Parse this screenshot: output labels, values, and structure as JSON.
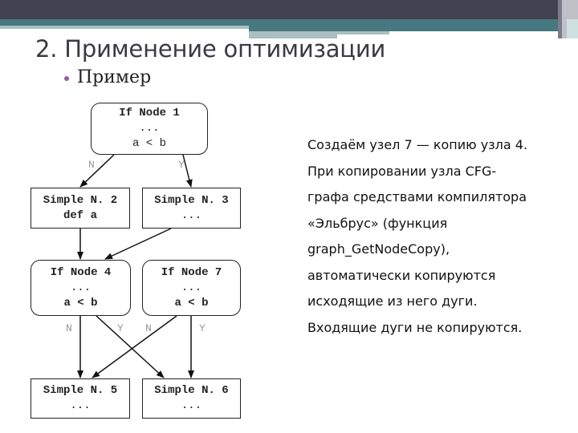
{
  "slide": {
    "title": "2. Применение оптимизации",
    "bullet": "Пример",
    "theme_colors": {
      "top_bar": "#41414f",
      "accent_teal": "#47787f",
      "accent_light": "#a9bfc1",
      "bullet": "#9a5aa0"
    }
  },
  "diagram": {
    "nodes": [
      {
        "id": "n1",
        "kind": "if",
        "lines": [
          "If Node 1",
          "...",
          "a < b"
        ]
      },
      {
        "id": "n2",
        "kind": "simple",
        "lines": [
          "Simple N. 2",
          "def a"
        ]
      },
      {
        "id": "n3",
        "kind": "simple",
        "lines": [
          "Simple N. 3",
          "..."
        ]
      },
      {
        "id": "n4",
        "kind": "if",
        "lines": [
          "If Node 4",
          "...",
          "a < b"
        ]
      },
      {
        "id": "n7",
        "kind": "if",
        "lines": [
          "If Node 7",
          "...",
          "a < b"
        ]
      },
      {
        "id": "n5",
        "kind": "simple",
        "lines": [
          "Simple N. 5",
          "..."
        ]
      },
      {
        "id": "n6",
        "kind": "simple",
        "lines": [
          "Simple N. 6",
          "..."
        ]
      }
    ],
    "edges": [
      {
        "from": "n1",
        "to": "n2",
        "label": "N"
      },
      {
        "from": "n1",
        "to": "n3",
        "label": "Y"
      },
      {
        "from": "n2",
        "to": "n4",
        "label": ""
      },
      {
        "from": "n3",
        "to": "n4",
        "label": ""
      },
      {
        "from": "n4",
        "to": "n5",
        "label": "N"
      },
      {
        "from": "n4",
        "to": "n6",
        "label": "Y"
      },
      {
        "from": "n7",
        "to": "n5",
        "label": "N"
      },
      {
        "from": "n7",
        "to": "n6",
        "label": "Y"
      }
    ]
  },
  "description": {
    "lines": [
      "Создаём узел 7 — копию узла 4.",
      "При копировании узла CFG-",
      "графа средствами компилятора",
      "«Эльбрус» (функция",
      "graph_GetNodeCopy),",
      "автоматически копируются",
      "исходящие из него дуги.",
      "Входящие дуги не копируются."
    ]
  }
}
